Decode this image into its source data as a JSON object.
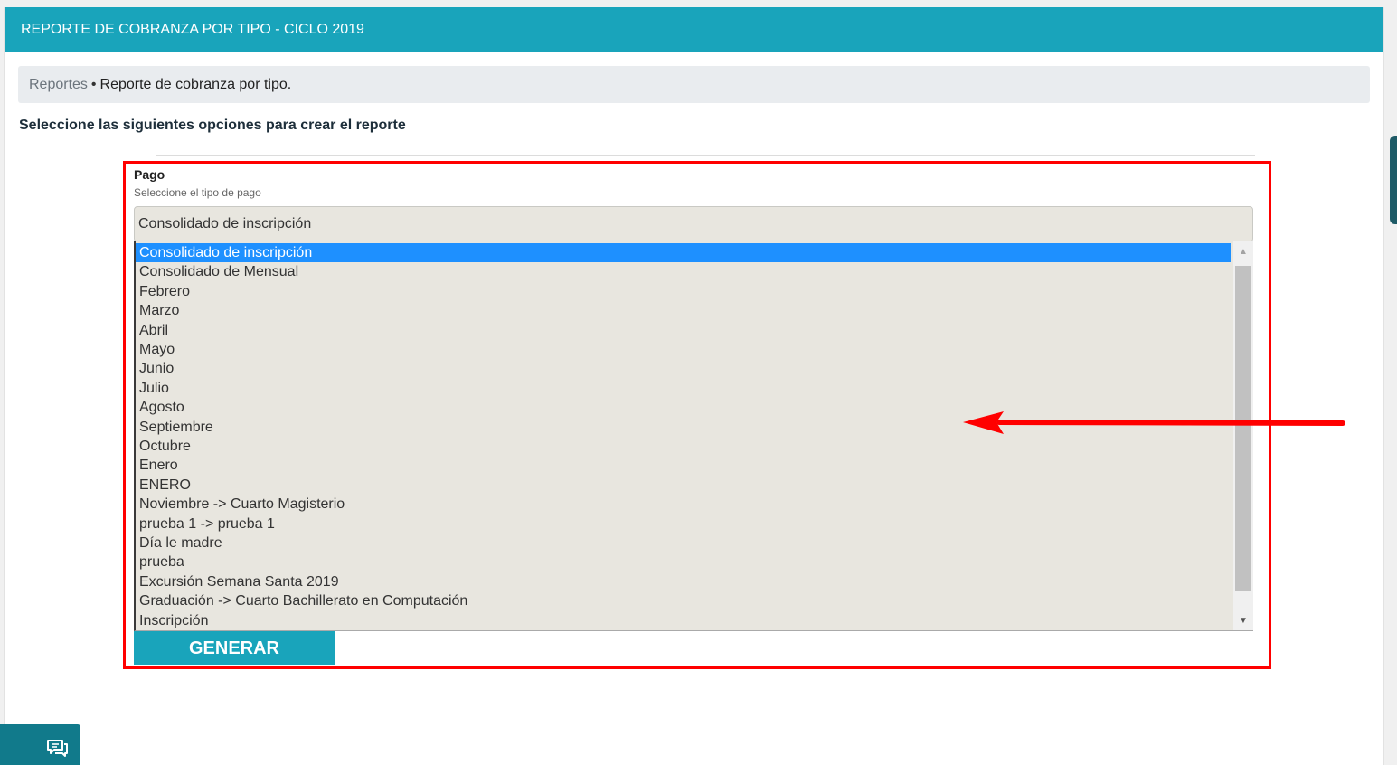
{
  "header": {
    "title": "REPORTE DE COBRANZA POR TIPO - CICLO 2019"
  },
  "breadcrumb": {
    "link": "Reportes",
    "separator": "•",
    "current": "Reporte de cobranza por tipo."
  },
  "instructions": "Seleccione las siguientes opciones para crear el reporte",
  "form": {
    "label": "Pago",
    "help": "Seleccione el tipo de pago",
    "selected_value": "Consolidado de inscripción",
    "options": [
      "Consolidado de inscripción",
      "Consolidado de Mensual",
      "Febrero",
      "Marzo",
      "Abril",
      "Mayo",
      "Junio",
      "Julio",
      "Agosto",
      "Septiembre",
      "Octubre",
      "Enero",
      "ENERO",
      "Noviembre -> Cuarto Magisterio",
      "prueba 1 -> prueba 1",
      "Día le madre",
      "prueba",
      "Excursión Semana Santa 2019",
      "Graduación -> Cuarto Bachillerato en Computación",
      "Inscripción"
    ],
    "selected_index": 0,
    "generate_label": "GENERAR"
  },
  "icons": {
    "chat": "chat-bubble-icon",
    "scroll_up": "triangle-up-icon",
    "scroll_down": "triangle-down-icon"
  },
  "colors": {
    "brand": "#19a4bb",
    "highlight": "#ff0000",
    "selection": "#1e90ff"
  }
}
